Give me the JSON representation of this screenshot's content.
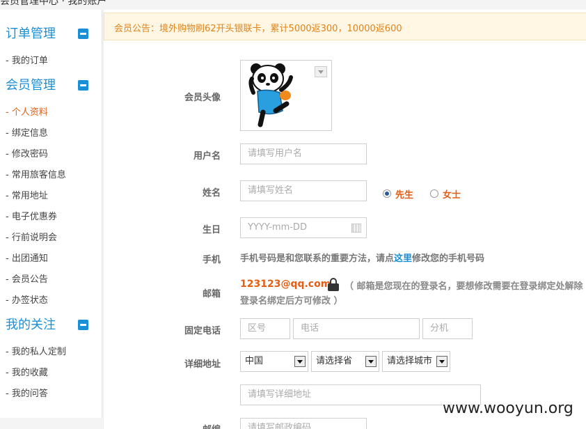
{
  "topbar": {
    "text": "会员管理中心  ·  我的账户"
  },
  "sidebar": {
    "sections": [
      {
        "title": "订单管理",
        "items": [
          "- 我的订单"
        ]
      },
      {
        "title": "会员管理",
        "items": [
          "- 个人资料",
          "- 绑定信息",
          "- 修改密码",
          "- 常用旅客信息",
          "- 常用地址",
          "- 电子优惠券",
          "- 行前说明会",
          "- 出团通知",
          "- 会员公告",
          "- 办签状态"
        ]
      },
      {
        "title": "我的关注",
        "items": [
          "- 我的私人定制",
          "- 我的收藏",
          "- 我的问答"
        ]
      }
    ],
    "active_item": "- 个人资料"
  },
  "notice": {
    "text": "会员公告：境外购物刷62开头银联卡，累计5000返300，10000返600"
  },
  "form": {
    "avatar_label": "会员头像",
    "username_label": "用户名",
    "username_placeholder": "请填写用户名",
    "name_label": "姓名",
    "name_placeholder": "请填写姓名",
    "gender_male": "先生",
    "gender_female": "女士",
    "gender_selected": "先生",
    "birthday_label": "生日",
    "birthday_placeholder": "YYYY-mm-DD",
    "phone_label": "手机",
    "phone_note_before": "手机号码是和您联系的重要方法，请点",
    "phone_note_link": "这里",
    "phone_note_after": "修改您的手机号码",
    "email_label": "邮箱",
    "email_value": "123123@qq.com",
    "email_note_line1": "（ 邮箱是您现在的登录名，要想修改需要在登录绑定处解除",
    "email_note_line2": "登录名绑定后方可修改 ）",
    "tel_label": "固定电话",
    "tel_area_placeholder": "区号",
    "tel_number_placeholder": "电话",
    "tel_ext_placeholder": "分机",
    "address_label": "详细地址",
    "country_value": "中国",
    "province_value": "请选择省",
    "city_value": "请选择城市",
    "address_placeholder": "请填写详细地址",
    "postcode_label": "邮编",
    "postcode_placeholder": "请填写邮政编码"
  },
  "watermark": "www.wooyun.org",
  "colors": {
    "accent": "#1a8fd6",
    "highlight": "#e45d14",
    "notice_bg": "#fff7e3",
    "notice_text": "#e0831a"
  }
}
